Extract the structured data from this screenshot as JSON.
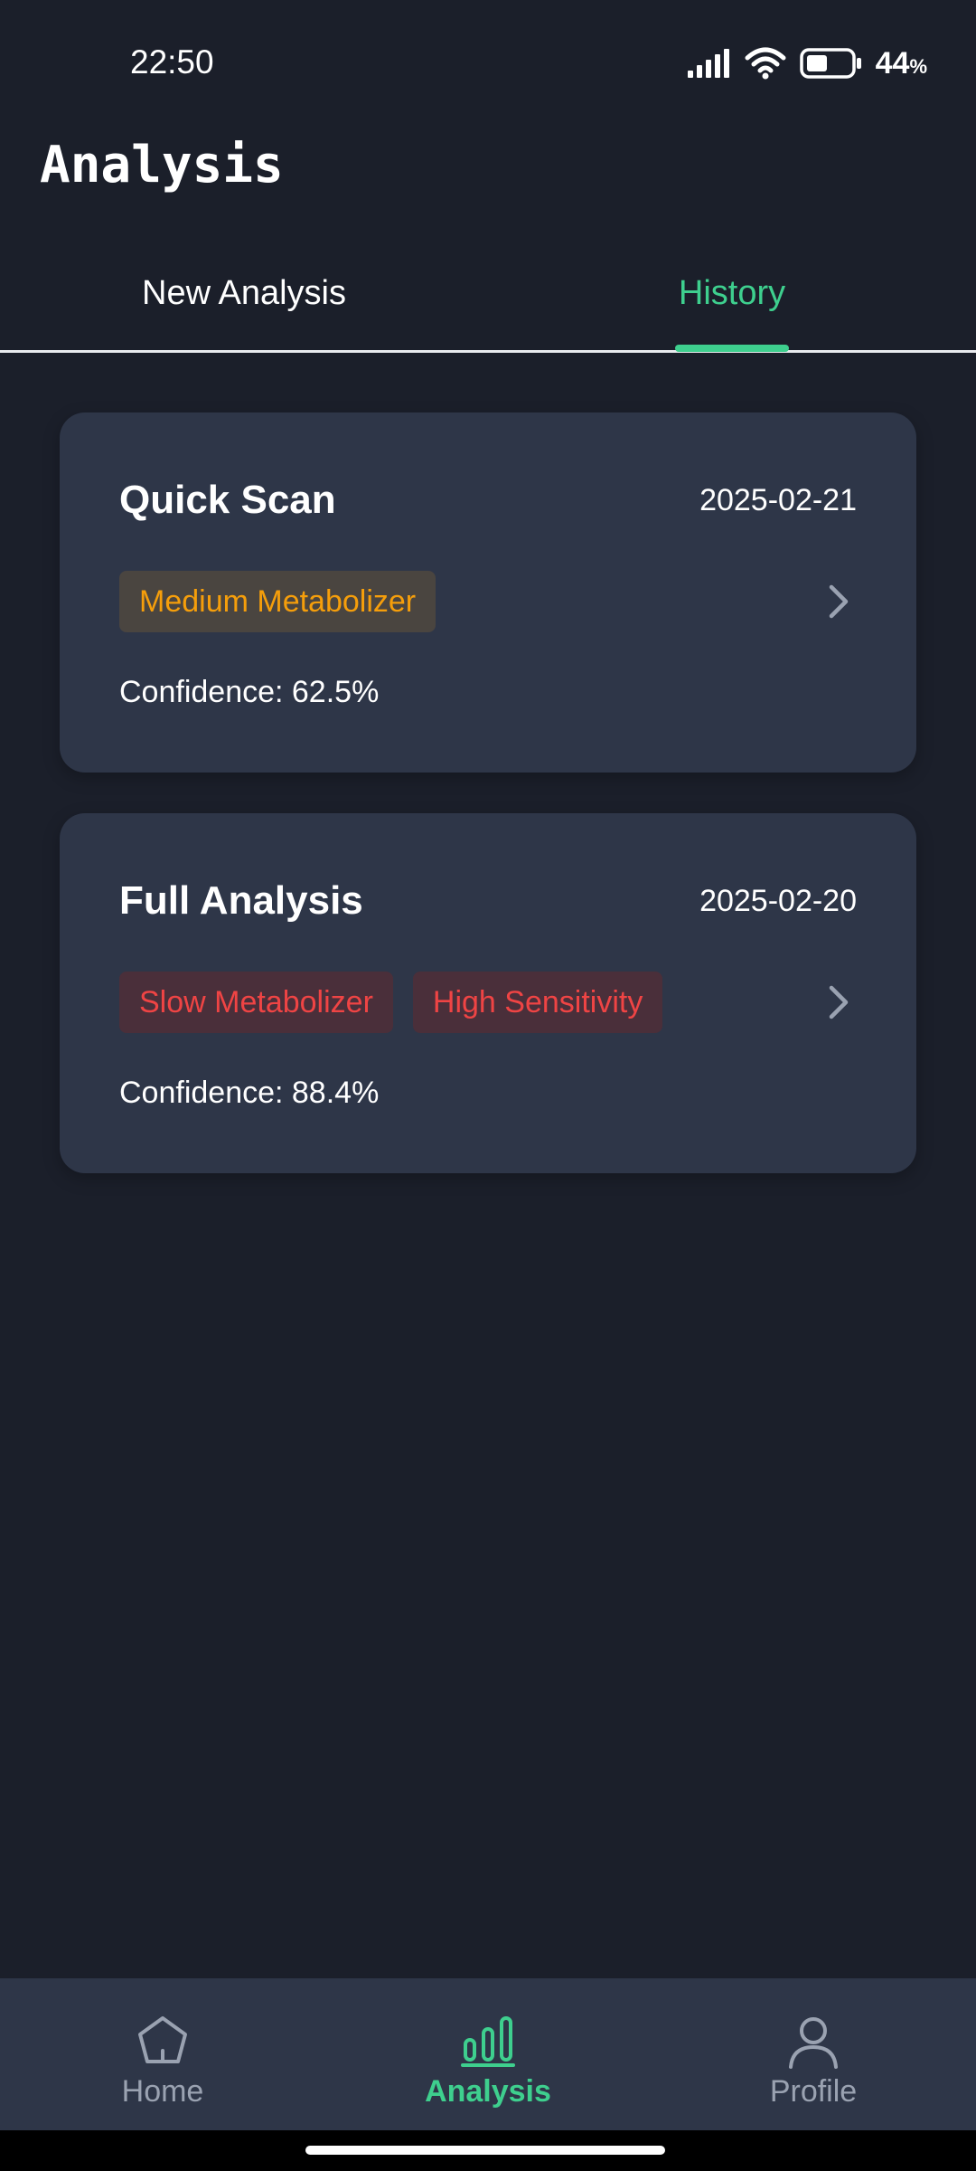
{
  "status_bar": {
    "time": "22:50",
    "battery_percent": "44",
    "battery_symbol": "%"
  },
  "header": {
    "title": "Analysis"
  },
  "tabs": [
    {
      "label": "New Analysis",
      "active": false
    },
    {
      "label": "History",
      "active": true
    }
  ],
  "history": [
    {
      "title": "Quick Scan",
      "date": "2025-02-21",
      "tags": [
        {
          "label": "Medium Metabolizer",
          "color": "#f59e0b"
        }
      ],
      "confidence": "Confidence: 62.5%"
    },
    {
      "title": "Full Analysis",
      "date": "2025-02-20",
      "tags": [
        {
          "label": "Slow Metabolizer",
          "color": "#ef4444"
        },
        {
          "label": "High Sensitivity",
          "color": "#ef4444"
        }
      ],
      "confidence": "Confidence: 88.4%"
    }
  ],
  "bottom_nav": [
    {
      "label": "Home",
      "icon": "home-icon",
      "active": false
    },
    {
      "label": "Analysis",
      "icon": "bar-chart-icon",
      "active": true
    },
    {
      "label": "Profile",
      "icon": "person-icon",
      "active": false
    }
  ],
  "colors": {
    "accent": "#3ecf8e",
    "background": "#1b1f2a",
    "card": "#2e3648",
    "warning": "#f59e0b",
    "danger": "#ef4444"
  }
}
